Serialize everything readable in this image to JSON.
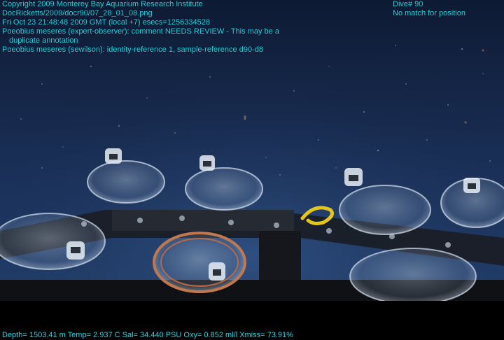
{
  "overlay": {
    "copyright": "Copyright 2009 Monterey Bay Aquarium Research Institute",
    "file_path": "DocRicketts/2009/docr90/07_28_01_08.png",
    "timestamp": "Fri Oct 23 21:48:48 2009 GMT (local +7)  esecs=1256334528",
    "annotation_1a": "Poeobius meseres (expert-observer): comment NEEDS REVIEW - This may be a",
    "annotation_1b": "duplicate annotation",
    "annotation_2": "Poeobius meseres (sewilson): identity-reference 1, sample-reference d90-d8",
    "dive": "Dive# 90",
    "position": "No match for position",
    "telemetry": "Depth= 1503.41 m  Temp= 2.937 C  Sal= 34.440 PSU  Oxy= 0.852 ml/l  Xmiss= 73.91%"
  },
  "colors": {
    "overlay_text": "#1fd8e8",
    "water_top": "#0e1a33",
    "water_bottom": "#1f3a66",
    "letterbox": "#000000"
  }
}
